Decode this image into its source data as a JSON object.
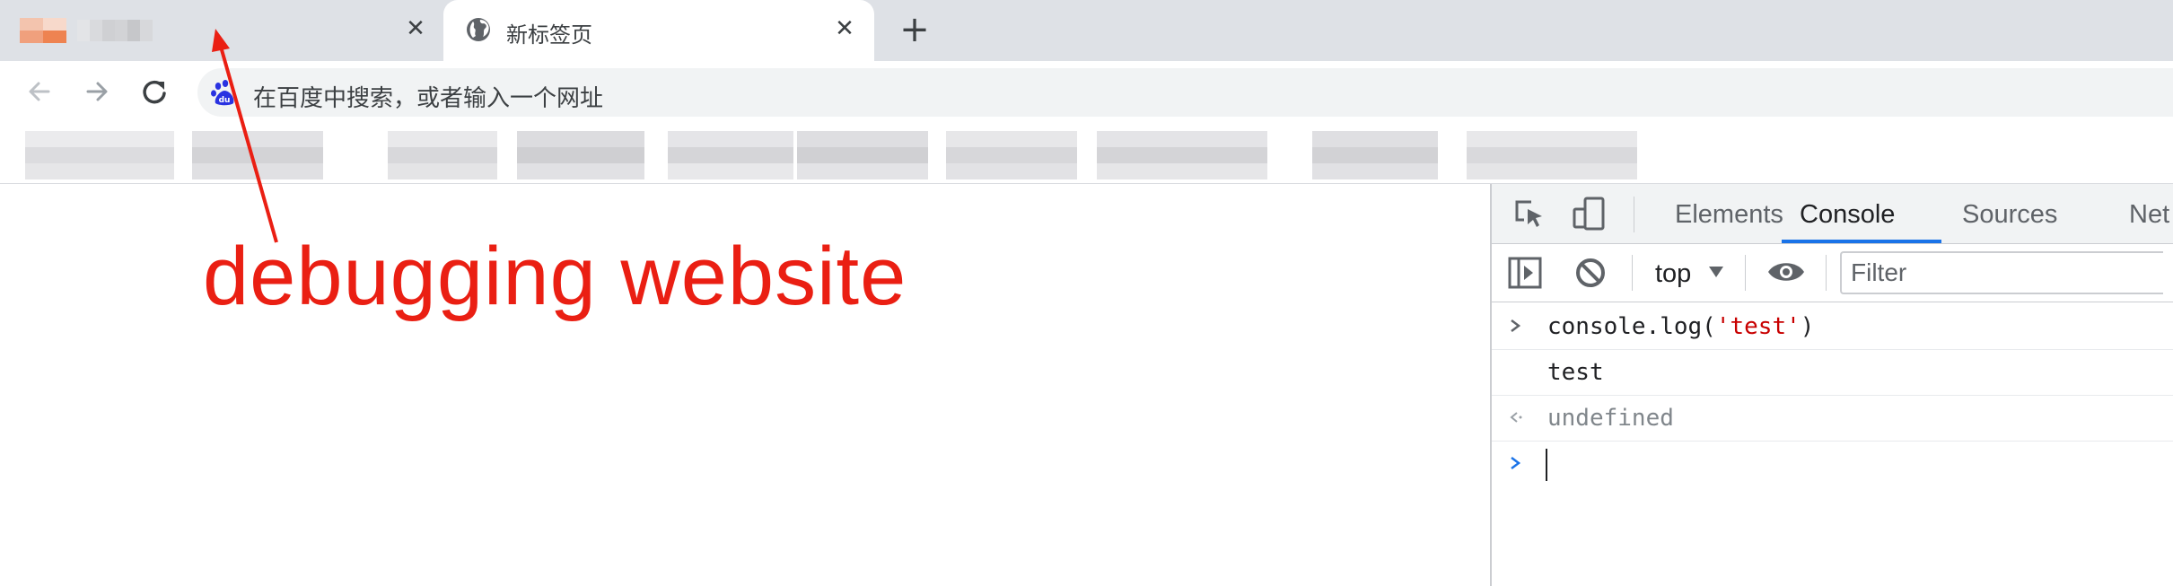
{
  "tabs": [
    {
      "title": "",
      "close_symbol": "✕"
    },
    {
      "title": "新标签页",
      "close_symbol": "✕",
      "favicon": "globe-icon"
    }
  ],
  "new_tab_symbol": "+",
  "toolbar": {
    "back_icon": "arrow-left-icon",
    "forward_icon": "arrow-right-icon",
    "reload_icon": "reload-icon",
    "omnibox_placeholder": "在百度中搜索，或者输入一个网址",
    "search_engine_icon": "baidu-icon"
  },
  "annotation": {
    "text": "debugging website",
    "color": "#ea1f13"
  },
  "devtools": {
    "tabs": [
      "Elements",
      "Console",
      "Sources",
      "Net"
    ],
    "active_tab": "Console",
    "console_toolbar": {
      "context": "top",
      "filter_placeholder": "Filter"
    },
    "console": [
      {
        "kind": "input",
        "parts": [
          "console.log(",
          "'test'",
          ")"
        ]
      },
      {
        "kind": "log",
        "text": "test"
      },
      {
        "kind": "result",
        "text": "undefined"
      },
      {
        "kind": "prompt",
        "text": ""
      }
    ]
  }
}
